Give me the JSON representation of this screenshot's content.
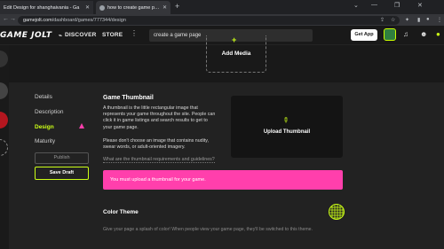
{
  "browser": {
    "tabs": [
      {
        "label": "Edit Design for shanghaivania - Ga"
      },
      {
        "label": "how to create game page on game"
      }
    ],
    "new_tab_glyph": "+",
    "address": {
      "host": "gamejolt.com",
      "path": "/dashboard/games/777344/design"
    }
  },
  "header": {
    "logo": "GAME JOLT",
    "nav": {
      "discover": "DISCOVER",
      "store": "STORE"
    },
    "search_value": "create a game page",
    "get_app": "Get App"
  },
  "media": {
    "label": "Add Media"
  },
  "sidebar": {
    "items": [
      {
        "label": "Details"
      },
      {
        "label": "Description"
      },
      {
        "label": "Design"
      },
      {
        "label": "Maturity"
      }
    ],
    "publish": "Publish",
    "save_draft": "Save Draft"
  },
  "thumbnail": {
    "title": "Game Thumbnail",
    "para1": "A thumbnail is the little rectangular image that represents your game throughout the site. People can click it in game listings and search results to get to your game page.",
    "para2": "Please don't choose an image that contains nudity, swear words, or adult-oriented imagery.",
    "link": "What are the thumbnail requirements and guidelines?",
    "upload": "Upload Thumbnail",
    "alert": "You must upload a thumbnail for your game."
  },
  "color_theme": {
    "title": "Color Theme",
    "hint": "Give your page a splash of color! When people view your game page, they'll be switched to this theme."
  },
  "colors": {
    "accent": "#ccff16",
    "alert": "#ff3fac",
    "bg": "#191919",
    "panel": "#222222"
  }
}
